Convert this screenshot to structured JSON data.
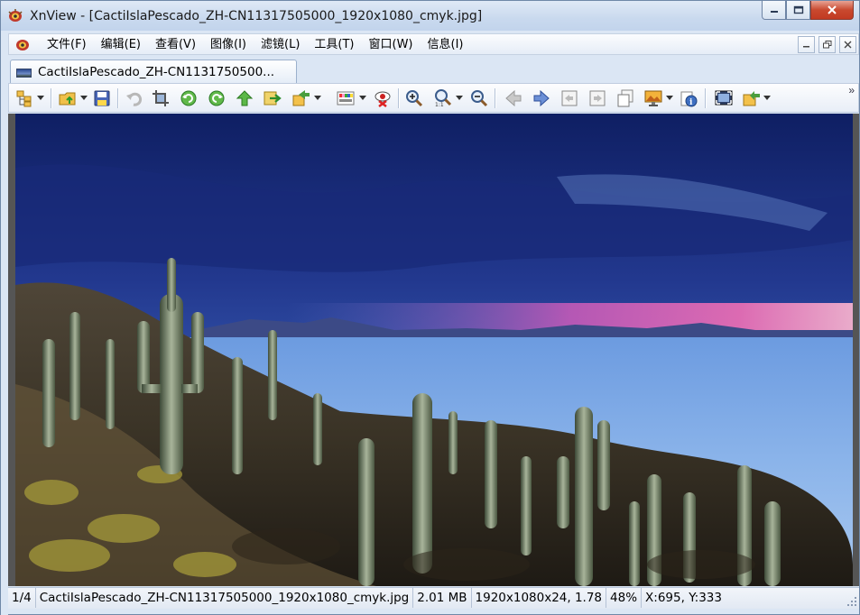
{
  "window": {
    "title": "XnView - [CactiIslaPescado_ZH-CN11317505000_1920x1080_cmyk.jpg]"
  },
  "menu": {
    "items": [
      "文件(F)",
      "编辑(E)",
      "查看(V)",
      "图像(I)",
      "滤镜(L)",
      "工具(T)",
      "窗口(W)",
      "信息(I)"
    ]
  },
  "tabs": [
    {
      "label": "CactiIslaPescado_ZH-CN1131750500...",
      "active": true
    }
  ],
  "toolbar": {
    "buttons": [
      "browser-icon",
      "open-folder-icon",
      "save-icon",
      "undo-icon",
      "crop-icon",
      "rotate-left-icon",
      "rotate-right-icon",
      "upload-icon",
      "export-icon",
      "convert-icon",
      "adjust-colors-icon",
      "red-eye-icon",
      "zoom-in-icon",
      "zoom-fit-icon",
      "zoom-out-icon",
      "previous-icon",
      "next-icon",
      "first-icon",
      "last-icon",
      "copy-icon",
      "wallpaper-icon",
      "properties-icon",
      "fullscreen-icon",
      "slideshow-icon"
    ],
    "more": "»"
  },
  "viewer": {
    "image_description": "Cacti on Isla Incahuasi at dusk over the Uyuni salt flat"
  },
  "status": {
    "index": "1/4",
    "filename": "CactiIslaPescado_ZH-CN11317505000_1920x1080_cmyk.jpg",
    "filesize": "2.01 MB",
    "dimensions": "1920x1080x24, 1.78",
    "zoom": "48%",
    "coords": "X:695, Y:333"
  },
  "colors": {
    "chrome": "#dbe6f4",
    "close_button": "#c9492f",
    "accent": "#2f6fc9"
  }
}
